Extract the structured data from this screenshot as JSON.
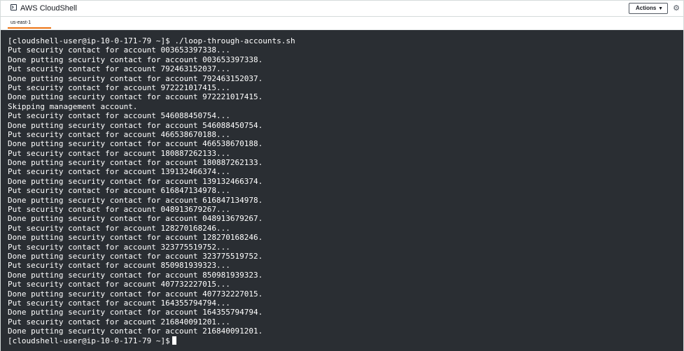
{
  "titlebar": {
    "app_icon": "terminal-icon",
    "title": "AWS CloudShell",
    "actions_label": "Actions",
    "actions_caret": "chevron-down-icon",
    "settings_icon": "gear-icon"
  },
  "tabs": [
    {
      "label": "us-east-1",
      "active": true,
      "accent": "#ec7211"
    }
  ],
  "terminal": {
    "background": "#2a2e33",
    "foreground": "#ffffff",
    "lines": [
      "[cloudshell-user@ip-10-0-171-79 ~]$ ./loop-through-accounts.sh",
      "Put security contact for account 003653397338...",
      "Done putting security contact for account 003653397338.",
      "Put security contact for account 792463152037...",
      "Done putting security contact for account 792463152037.",
      "Put security contact for account 972221017415...",
      "Done putting security contact for account 972221017415.",
      "Skipping management account.",
      "Put security contact for account 546088450754...",
      "Done putting security contact for account 546088450754.",
      "Put security contact for account 466538670188...",
      "Done putting security contact for account 466538670188.",
      "Put security contact for account 180887262133...",
      "Done putting security contact for account 180887262133.",
      "Put security contact for account 139132466374...",
      "Done putting security contact for account 139132466374.",
      "Put security contact for account 616847134978...",
      "Done putting security contact for account 616847134978.",
      "Put security contact for account 048913679267...",
      "Done putting security contact for account 048913679267.",
      "Put security contact for account 128270168246...",
      "Done putting security contact for account 128270168246.",
      "Put security contact for account 323775519752...",
      "Done putting security contact for account 323775519752.",
      "Put security contact for account 850981939323...",
      "Done putting security contact for account 850981939323.",
      "Put security contact for account 407732227015...",
      "Done putting security contact for account 407732227015.",
      "Put security contact for account 164355794794...",
      "Done putting security contact for account 164355794794.",
      "Put security contact for account 216840091201...",
      "Done putting security contact for account 216840091201."
    ],
    "prompt": "[cloudshell-user@ip-10-0-171-79 ~]$"
  }
}
